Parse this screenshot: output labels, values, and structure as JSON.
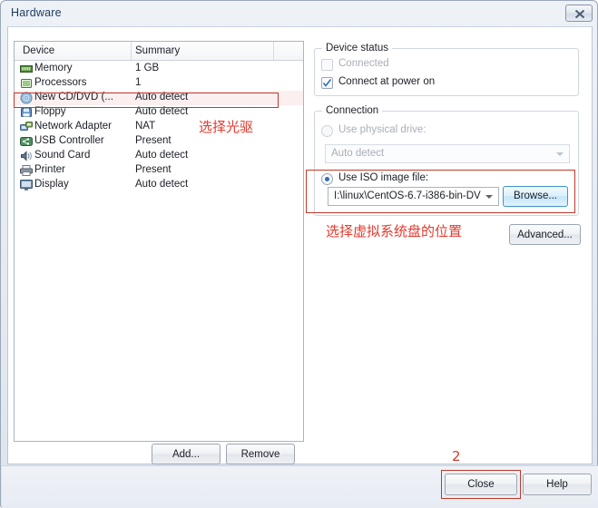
{
  "window": {
    "title": "Hardware",
    "close_icon": "close-icon"
  },
  "device_list": {
    "columns": [
      "Device",
      "Summary"
    ],
    "rows": [
      {
        "icon": "memory-icon",
        "name": "Memory",
        "summary": "1 GB",
        "selected": false
      },
      {
        "icon": "processor-icon",
        "name": "Processors",
        "summary": "1",
        "selected": false
      },
      {
        "icon": "cd-dvd-icon",
        "name": "New CD/DVD (...",
        "summary": "Auto detect",
        "selected": true
      },
      {
        "icon": "floppy-icon",
        "name": "Floppy",
        "summary": "Auto detect",
        "selected": false
      },
      {
        "icon": "network-adapter-icon",
        "name": "Network Adapter",
        "summary": "NAT",
        "selected": false
      },
      {
        "icon": "usb-controller-icon",
        "name": "USB Controller",
        "summary": "Present",
        "selected": false
      },
      {
        "icon": "sound-card-icon",
        "name": "Sound Card",
        "summary": "Auto detect",
        "selected": false
      },
      {
        "icon": "printer-icon",
        "name": "Printer",
        "summary": "Present",
        "selected": false
      },
      {
        "icon": "display-icon",
        "name": "Display",
        "summary": "Auto detect",
        "selected": false
      }
    ],
    "add_label": "Add...",
    "remove_label": "Remove"
  },
  "device_status": {
    "group_title": "Device status",
    "connected_label": "Connected",
    "connected_checked": false,
    "connected_disabled": true,
    "connect_at_power_on_label": "Connect at power on",
    "connect_at_power_on_checked": true
  },
  "connection": {
    "group_title": "Connection",
    "physical_drive_label": "Use physical drive:",
    "physical_drive_selected": false,
    "physical_drive_value": "Auto detect",
    "iso_label": "Use ISO image file:",
    "iso_selected": true,
    "iso_value": "I:\\linux\\CentOS-6.7-i386-bin-DV",
    "browse_label": "Browse...",
    "advanced_label": "Advanced..."
  },
  "footer": {
    "close_label": "Close",
    "help_label": "Help"
  },
  "annotations": {
    "select_optical_drive": "选择光驱",
    "select_iso_location": "选择虚拟系统盘的位置",
    "step_two": "2",
    "accent_color": "#e23a2e",
    "box_color": "#c0392b"
  }
}
